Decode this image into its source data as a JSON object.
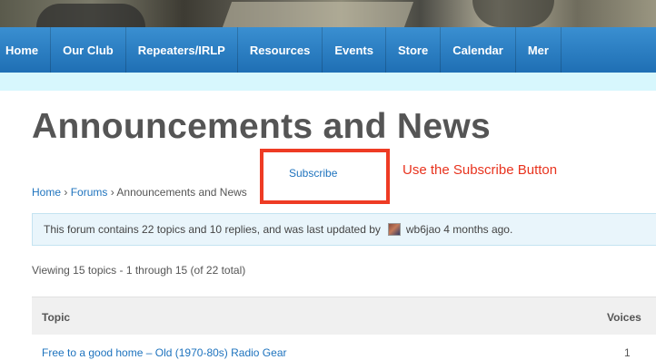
{
  "nav": {
    "items": [
      "Home",
      "Our Club",
      "Repeaters/IRLP",
      "Resources",
      "Events",
      "Store",
      "Calendar",
      "Mer"
    ]
  },
  "page": {
    "title": "Announcements and News"
  },
  "breadcrumb": {
    "home": "Home",
    "separator": "›",
    "forums": "Forums",
    "current": "Announcements and News"
  },
  "subscribe": {
    "label": "Subscribe",
    "callout": "Use the Subscribe Button"
  },
  "info": {
    "text": "This forum contains 22 topics and 10 replies, and was last updated by",
    "user": "wb6jao",
    "time": "4 months ago."
  },
  "viewing": "Viewing 15 topics - 1 through 15 (of 22 total)",
  "table": {
    "headers": {
      "topic": "Topic",
      "voices": "Voices"
    },
    "rows": [
      {
        "topic": "Free to a good home – Old (1970-80s) Radio Gear",
        "voices": "1"
      }
    ]
  },
  "colors": {
    "nav": "#1f6fb4",
    "link": "#1e73be",
    "highlight": "#ee3b24",
    "strip": "#d7f7fd"
  },
  "icons": {
    "avatar": "user-avatar"
  }
}
